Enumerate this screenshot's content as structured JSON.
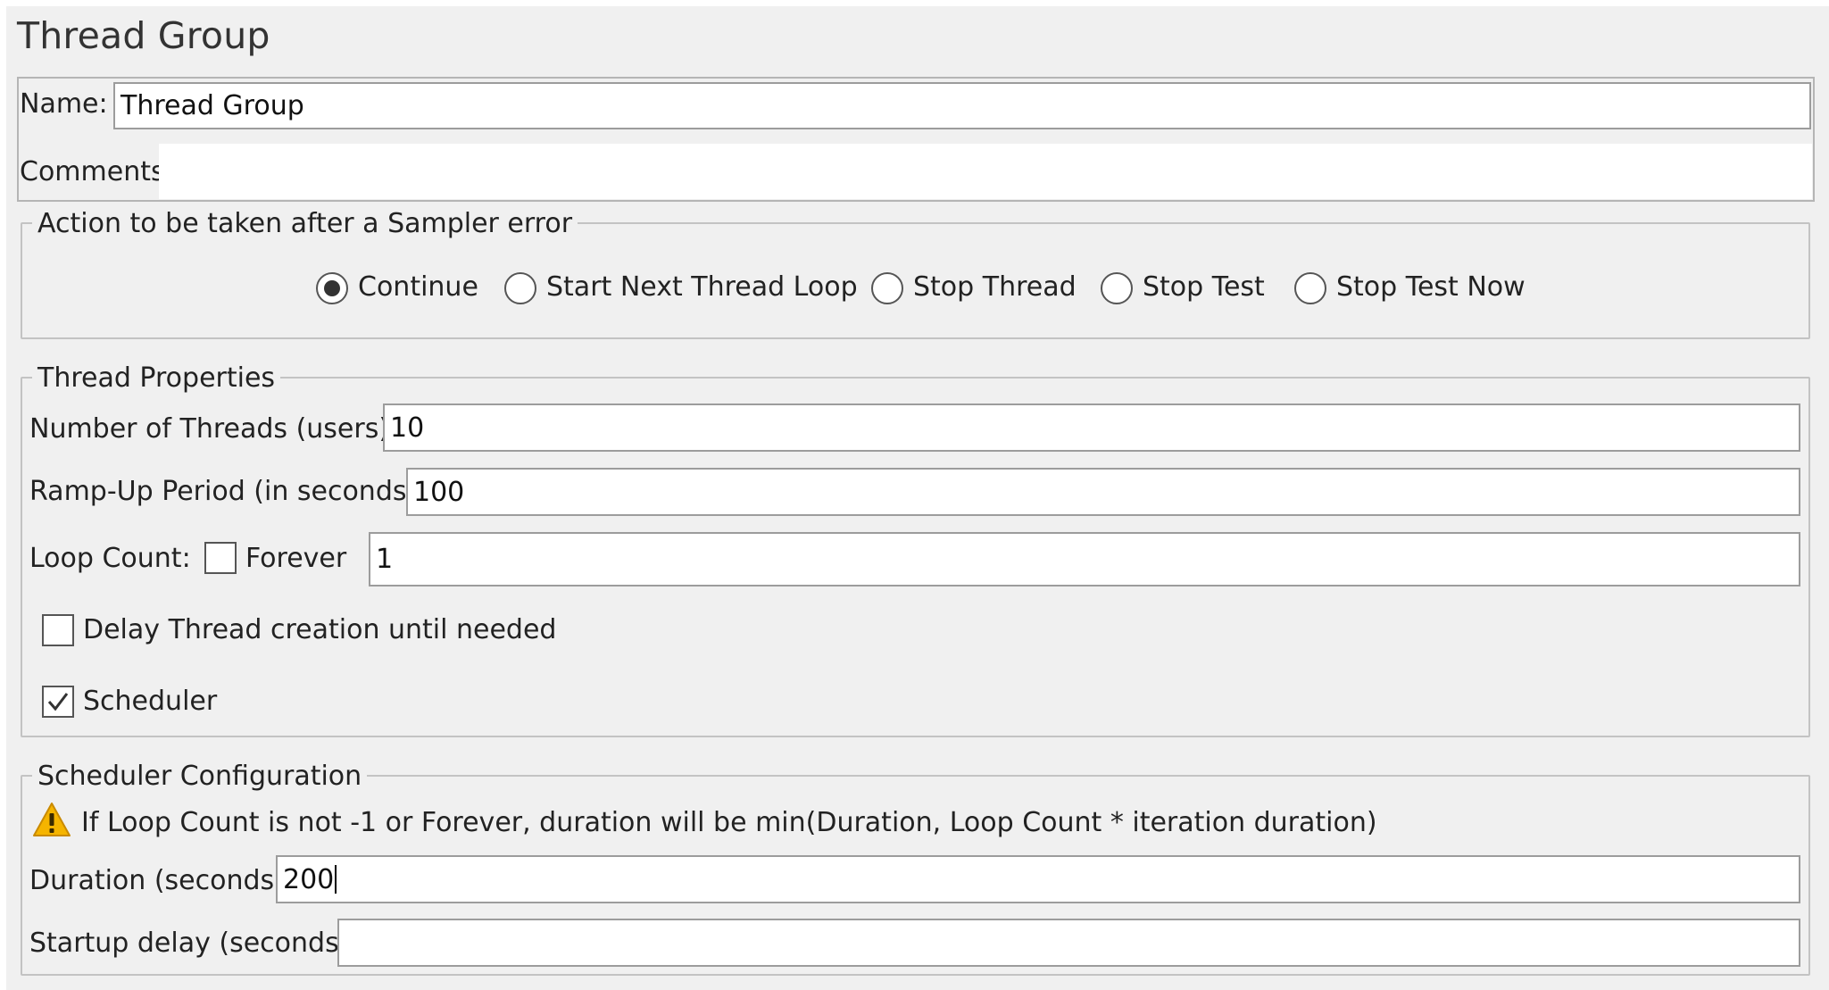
{
  "panel": {
    "title": "Thread Group"
  },
  "name_field": {
    "label": "Name:",
    "value": "Thread Group"
  },
  "comments_field": {
    "label": "Comments:",
    "value": ""
  },
  "sampler_error": {
    "legend": "Action to be taken after a Sampler error",
    "options": [
      {
        "label": "Continue",
        "selected": true
      },
      {
        "label": "Start Next Thread Loop",
        "selected": false
      },
      {
        "label": "Stop Thread",
        "selected": false
      },
      {
        "label": "Stop Test",
        "selected": false
      },
      {
        "label": "Stop Test Now",
        "selected": false
      }
    ]
  },
  "thread_properties": {
    "legend": "Thread Properties",
    "num_threads": {
      "label": "Number of Threads (users):",
      "value": "10"
    },
    "ramp_up": {
      "label": "Ramp-Up Period (in seconds):",
      "value": "100"
    },
    "loop_count": {
      "label": "Loop Count:",
      "forever_label": "Forever",
      "forever_checked": false,
      "value": "1"
    },
    "delay_creation": {
      "label": "Delay Thread creation until needed",
      "checked": false
    },
    "scheduler": {
      "label": "Scheduler",
      "checked": true
    }
  },
  "scheduler_config": {
    "legend": "Scheduler Configuration",
    "warning_icon": "warning-triangle-icon",
    "warning_text": "If Loop Count is not -1 or Forever, duration will be min(Duration, Loop Count * iteration duration)",
    "duration": {
      "label": "Duration (seconds)",
      "value": "200"
    },
    "startup_delay": {
      "label": "Startup delay (seconds)",
      "value": ""
    }
  },
  "colors": {
    "background": "#f0f0f0",
    "field": "#ffffff",
    "warning": "#f5b400"
  }
}
